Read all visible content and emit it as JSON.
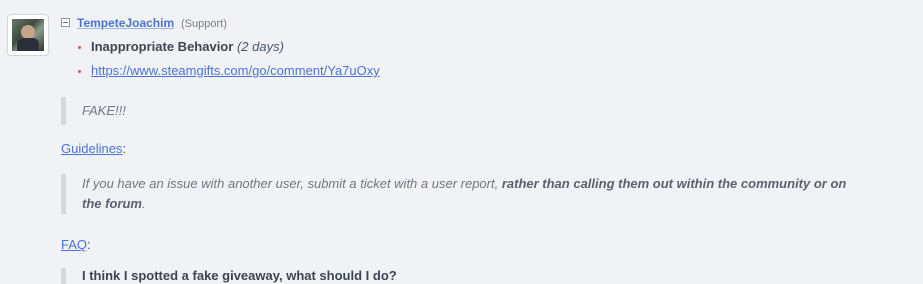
{
  "user": {
    "name": "TempeteJoachim",
    "role": "(Support)"
  },
  "report": {
    "reason": "Inappropriate Behavior",
    "duration": "(2 days)",
    "link": "https://www.steamgifts.com/go/comment/Ya7uOxy"
  },
  "quote_main": "FAKE!!!",
  "guidelines": {
    "label": "Guidelines",
    "suffix": ":",
    "text_normal": "If you have an issue with another user, submit a ticket with a user report, ",
    "text_bold": "rather than calling them out within the community or on the forum",
    "text_end": "."
  },
  "faq": {
    "label": "FAQ",
    "suffix": ":",
    "question": "I think I spotted a fake giveaway, what should I do?"
  },
  "icons": {
    "collapse": "minus-square-icon",
    "bullet": "bullet-icon"
  }
}
